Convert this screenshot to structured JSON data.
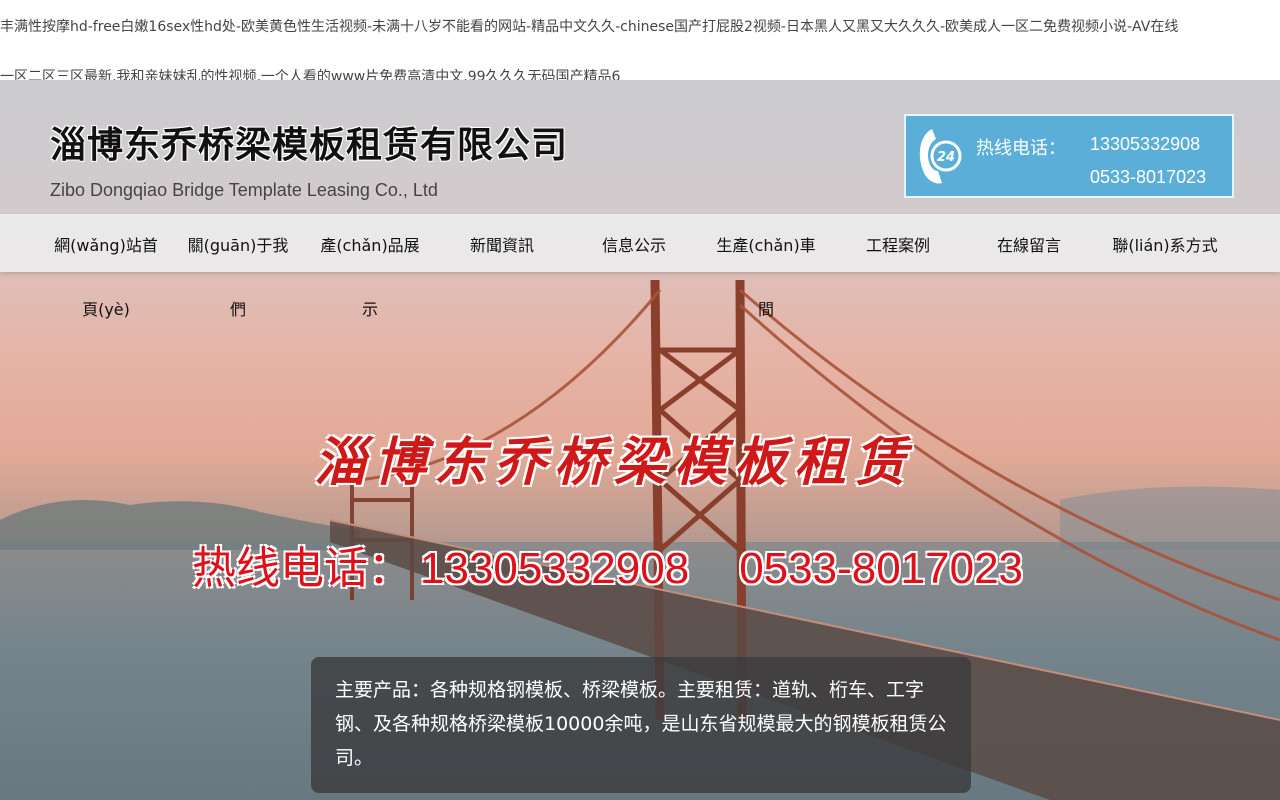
{
  "top_links": {
    "line1": "丰满性按摩hd-free白嫩16sex性hd处-欧美黄色性生活视频-未满十八岁不能看的网站-精品中文久久-chinese国产打屁股2视频-日本黑人又黑又大久久久-欧美成人一区二免费视频小说-AV在线",
    "line2": "一区二区三区最新,我和亲妹妹乱的性视频,一个人看的www片免费高清中文,99久久久无码国产精品6"
  },
  "header": {
    "logo_cn": "淄博东乔桥梁模板租赁有限公司",
    "logo_en": "Zibo Dongqiao Bridge Template Leasing Co., Ltd",
    "hotline_label": "热线电话：",
    "hotline_mobile": "13305332908",
    "hotline_phone": "0533-8017023",
    "hotline_icon": "phone-24h-icon",
    "hotline_bg": "#5aaed8"
  },
  "nav": [
    {
      "l1": "網(wǎng)站首",
      "l2": "頁(yè)"
    },
    {
      "l1": "關(guān)于我",
      "l2": "們"
    },
    {
      "l1": "產(chǎn)品展",
      "l2": "示"
    },
    {
      "l1": "新聞資訊",
      "l2": ""
    },
    {
      "l1": "信息公示",
      "l2": ""
    },
    {
      "l1": "生產(chǎn)車",
      "l2": "間"
    },
    {
      "l1": "工程案例",
      "l2": ""
    },
    {
      "l1": "在線留言",
      "l2": ""
    },
    {
      "l1": "聯(lián)系方式",
      "l2": ""
    }
  ],
  "banner": {
    "title": "淄博东乔桥梁模板租赁",
    "hotline_label": "热线电话：",
    "mobile": "13305332908",
    "phone": "0533-8017023",
    "accent": "#e0101a",
    "description": "主要产品：各种规格钢模板、桥梁模板。主要租赁：道轨、桁车、工字钢、及各种规格桥梁模板10000余吨，是山东省规模最大的钢模板租赁公司。"
  }
}
